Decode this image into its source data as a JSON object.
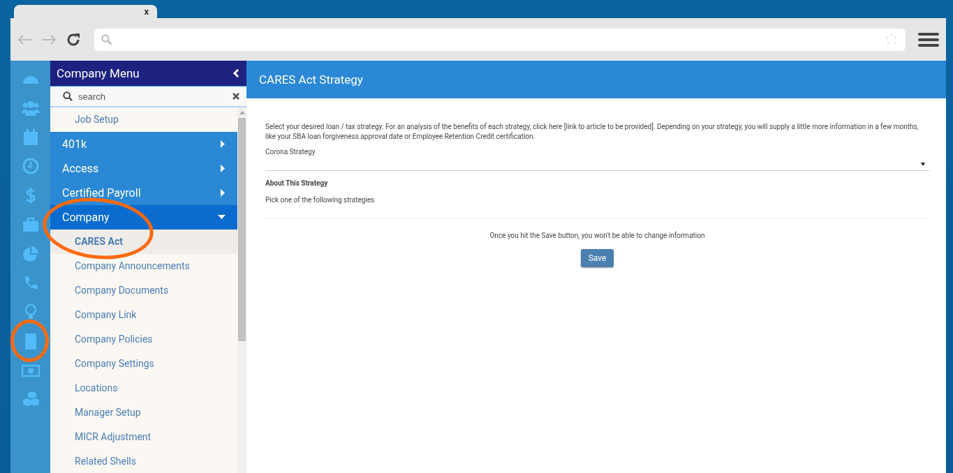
{
  "browser": {
    "tab_close": "x"
  },
  "menu": {
    "title": "Company Menu",
    "search": {
      "placeholder": "search"
    },
    "items": [
      {
        "kind": "child",
        "label": "Job Setup",
        "selected": false
      },
      {
        "kind": "group",
        "label": "401k",
        "expanded": false
      },
      {
        "kind": "group",
        "label": "Access",
        "expanded": false
      },
      {
        "kind": "group",
        "label": "Certified Payroll",
        "expanded": false
      },
      {
        "kind": "group",
        "label": "Company",
        "expanded": true,
        "children": [
          {
            "label": "CARES Act",
            "selected": true
          },
          {
            "label": "Company Announcements",
            "selected": false
          },
          {
            "label": "Company Documents",
            "selected": false
          },
          {
            "label": "Company Link",
            "selected": false
          },
          {
            "label": "Company Policies",
            "selected": false
          },
          {
            "label": "Company Settings",
            "selected": false
          },
          {
            "label": "Locations",
            "selected": false
          },
          {
            "label": "Manager Setup",
            "selected": false
          },
          {
            "label": "MICR Adjustment",
            "selected": false
          },
          {
            "label": "Related Shells",
            "selected": false
          }
        ]
      }
    ]
  },
  "page": {
    "title": "CARES Act Strategy",
    "intro": "Select your desired loan / tax strategy. For an analysis of the benefits of each strategy, click here [link to article to be provided]. Depending on your strategy, you will supply a little more information in a few months, like your SBA loan forgiveness approval date or Employee Retention Credit certification.",
    "field_label": "Corona Strategy",
    "about_heading": "About This Strategy",
    "about_text": "Pick one of the following strategies",
    "warning": "Once you hit the Save button, you won't be able to change information",
    "save": "Save"
  }
}
